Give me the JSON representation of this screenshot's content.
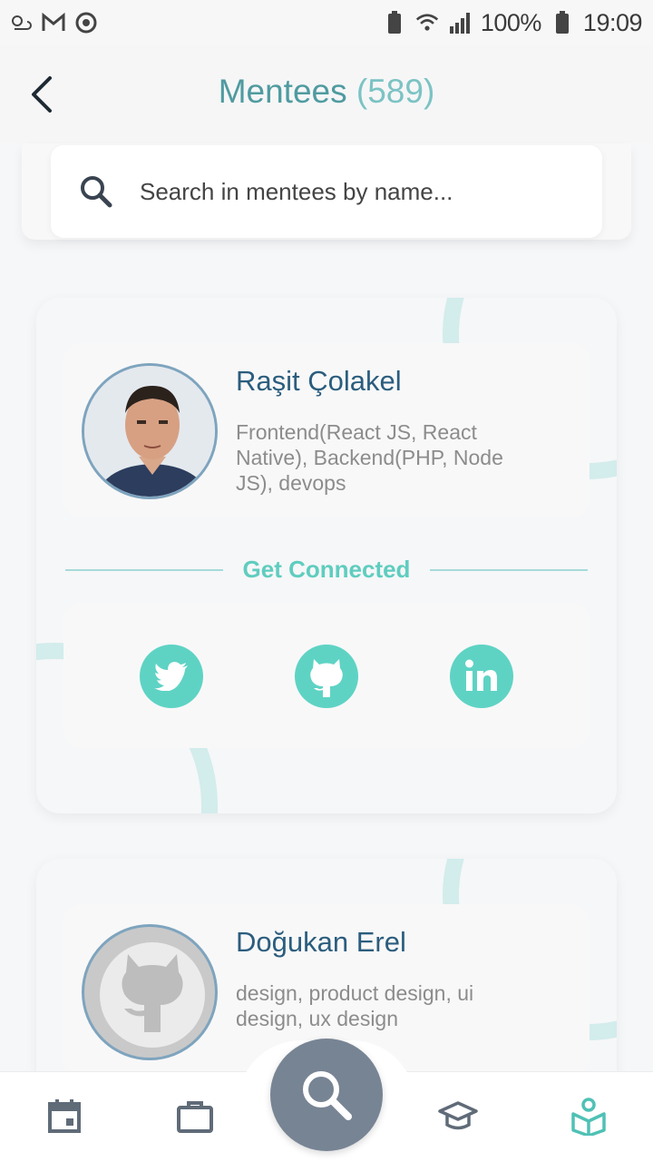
{
  "status_bar": {
    "battery": "100%",
    "time": "19:09",
    "left_icons": [
      "weather-icon",
      "gmail-icon",
      "sync-icon"
    ],
    "right_icons": [
      "battery-saver-icon",
      "wifi-icon",
      "signal-icon",
      "battery-icon"
    ]
  },
  "header": {
    "title": "Mentees",
    "count": "(589)"
  },
  "search": {
    "placeholder": "Search in mentees by name..."
  },
  "mentees": [
    {
      "name": "Raşit Çolakel",
      "skills": "Frontend(React JS, React Native), Backend(PHP, Node JS), devops",
      "connect_label": "Get Connected",
      "social": [
        "twitter",
        "github",
        "linkedin"
      ]
    },
    {
      "name": "Doğukan Erel",
      "skills": "design, product design, ui design, ux design"
    }
  ],
  "bottom_nav": {
    "items": [
      "calendar-icon",
      "briefcase-icon",
      "search-icon",
      "graduation-cap-icon",
      "mentee-reading-icon"
    ],
    "active": "mentee-reading-icon"
  },
  "colors": {
    "accent": "#5ed3c4",
    "title": "#4f9ba0",
    "name": "#2b5d7e",
    "fab": "#778494"
  }
}
